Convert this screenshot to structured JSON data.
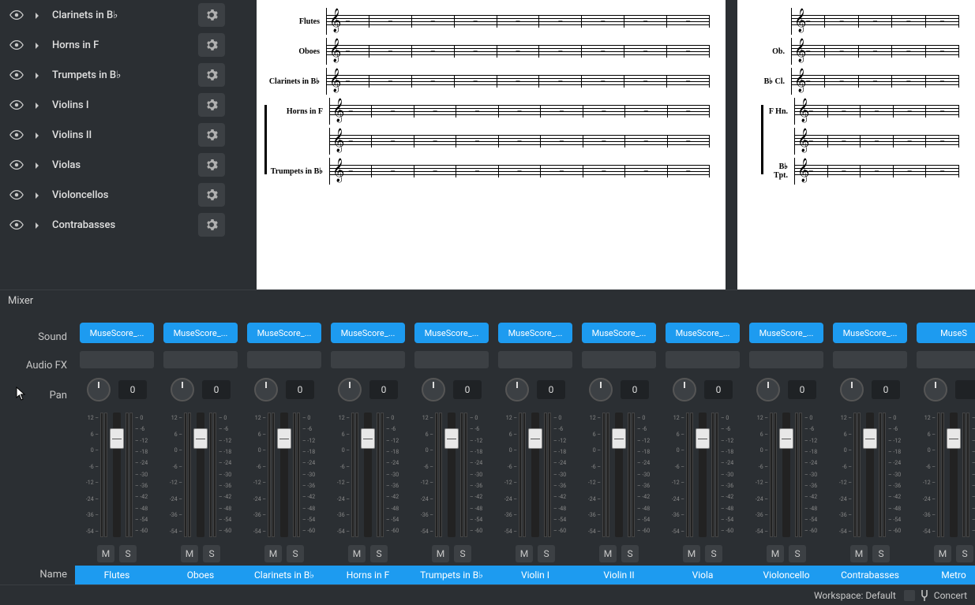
{
  "instruments": [
    {
      "label": "Clarinets in B♭"
    },
    {
      "label": "Horns in F"
    },
    {
      "label": "Trumpets in B♭"
    },
    {
      "label": "Violins I"
    },
    {
      "label": "Violins II"
    },
    {
      "label": "Violas"
    },
    {
      "label": "Violoncellos"
    },
    {
      "label": "Contrabasses"
    }
  ],
  "score_main": [
    {
      "label": "Flutes"
    },
    {
      "label": "Oboes"
    },
    {
      "label": "Clarinets in B♭"
    },
    {
      "label": "Horns in F",
      "group_start": true
    },
    {
      "label": "",
      "spacer": true
    },
    {
      "label": "Trumpets in B♭"
    }
  ],
  "score_side": [
    {
      "label": ""
    },
    {
      "label": "Ob."
    },
    {
      "label": "B♭ Cl."
    },
    {
      "label": "F Hn.",
      "group_start": true
    },
    {
      "label": "",
      "spacer": true
    },
    {
      "label": "B♭ Tpt."
    }
  ],
  "fader_scale_left": [
    "12",
    "6",
    "0",
    "-6",
    "-12",
    "-24",
    "-36",
    "-54"
  ],
  "fader_scale_right": [
    "0",
    "-6",
    "-12",
    "-18",
    "-24",
    "-30",
    "-36",
    "-42",
    "-48",
    "-54",
    "-60"
  ],
  "mixer": {
    "title": "Mixer",
    "labels": {
      "sound": "Sound",
      "fx": "Audio FX",
      "pan": "Pan",
      "name": "Name"
    },
    "channels": [
      {
        "sound": "MuseScore_...",
        "pan": 0,
        "name": "Flutes"
      },
      {
        "sound": "MuseScore_...",
        "pan": 0,
        "name": "Oboes"
      },
      {
        "sound": "MuseScore_...",
        "pan": 0,
        "name": "Clarinets in B♭"
      },
      {
        "sound": "MuseScore_...",
        "pan": 0,
        "name": "Horns in F"
      },
      {
        "sound": "MuseScore_...",
        "pan": 0,
        "name": "Trumpets in B♭"
      },
      {
        "sound": "MuseScore_...",
        "pan": 0,
        "name": "Violin I"
      },
      {
        "sound": "MuseScore_...",
        "pan": 0,
        "name": "Violin II"
      },
      {
        "sound": "MuseScore_...",
        "pan": 0,
        "name": "Viola"
      },
      {
        "sound": "MuseScore_...",
        "pan": 0,
        "name": "Violoncello"
      },
      {
        "sound": "MuseScore_...",
        "pan": 0,
        "name": "Contrabasses"
      },
      {
        "sound": "MuseS",
        "pan": "",
        "name": "Metro",
        "partial": true
      }
    ],
    "mute": "M",
    "solo": "S"
  },
  "status": {
    "workspace": "Workspace: Default",
    "concert": "Concert"
  }
}
